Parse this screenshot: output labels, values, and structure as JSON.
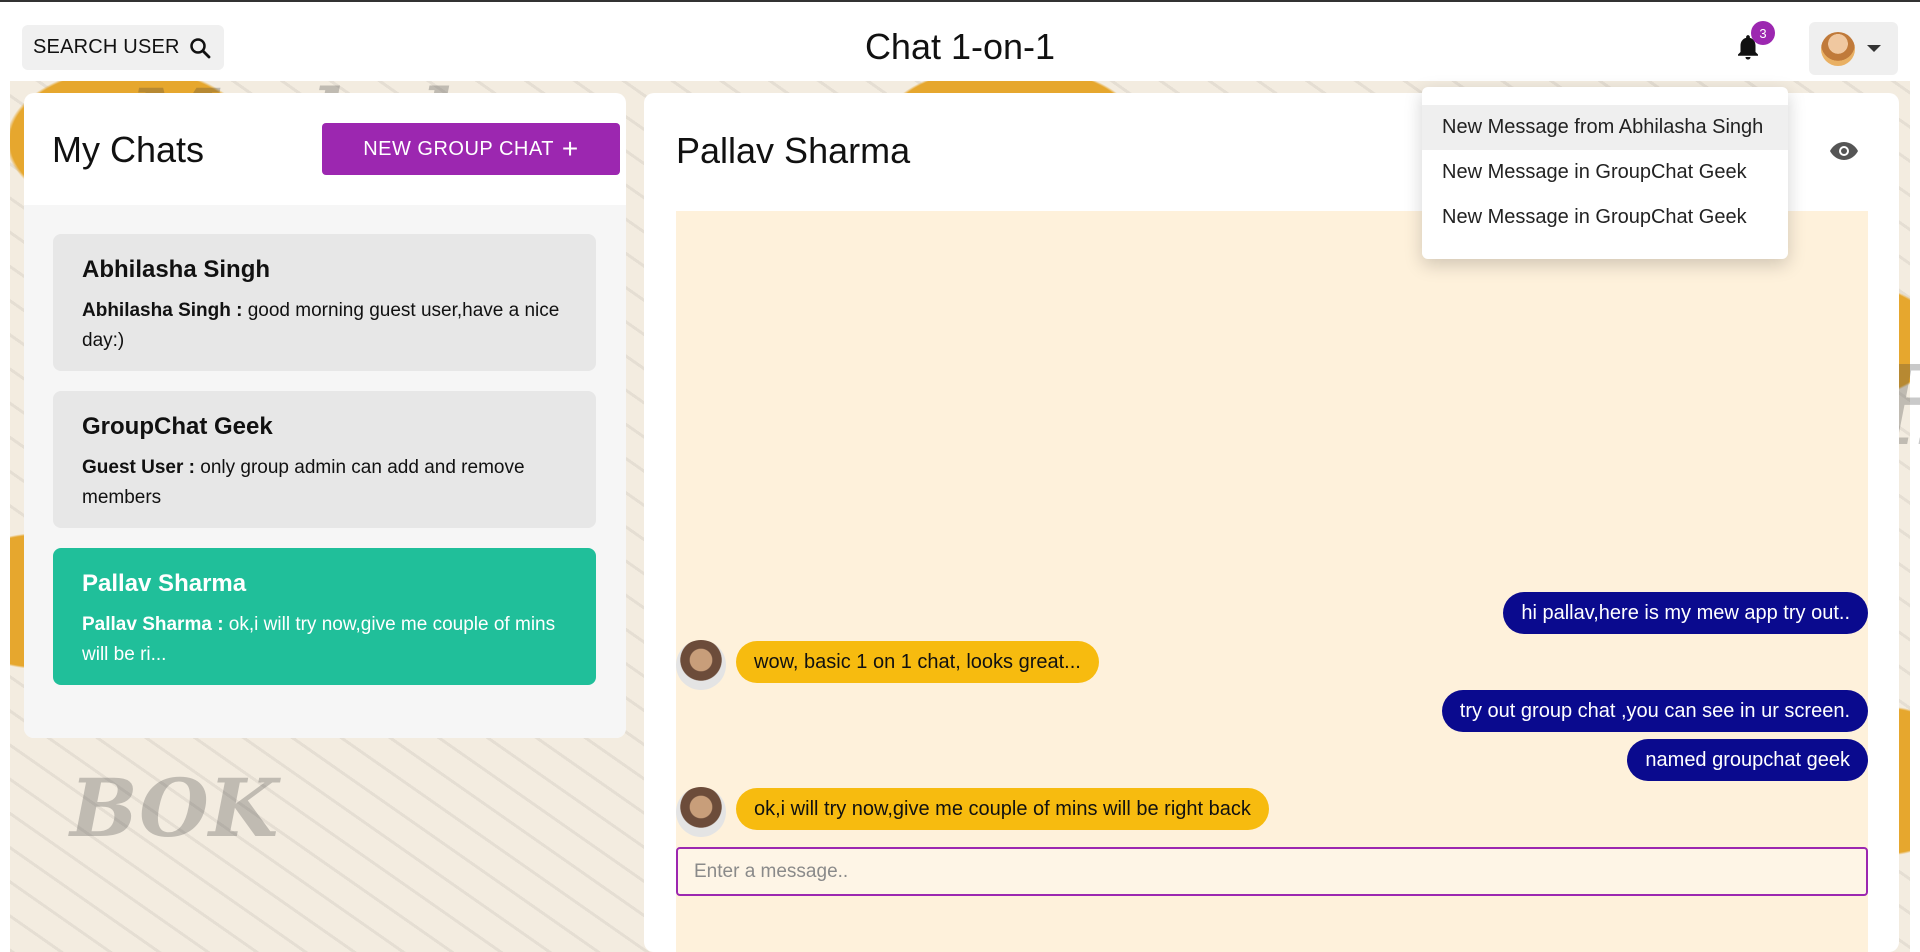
{
  "header": {
    "search_label": "SEARCH USER",
    "title": "Chat 1-on-1",
    "notification_count": "3"
  },
  "notifications": [
    "New Message from Abhilasha Singh",
    "New Message in GroupChat Geek",
    "New Message in GroupChat Geek"
  ],
  "sidebar": {
    "title": "My Chats",
    "new_group_label": "NEW GROUP CHAT",
    "chats": [
      {
        "name": "Abhilasha Singh",
        "sender": "Abhilasha Singh :",
        "message": " good morning guest user,have a nice day:)",
        "active": false
      },
      {
        "name": "GroupChat Geek",
        "sender": "Guest User :",
        "message": " only group admin can add and remove members",
        "active": false
      },
      {
        "name": "Pallav Sharma",
        "sender": "Pallav Sharma :",
        "message": " ok,i will try now,give me couple of mins will be ri...",
        "active": true
      }
    ]
  },
  "chat": {
    "title": "Pallav Sharma",
    "messages": [
      {
        "text": "hi pallav,here is my mew app try out..",
        "mine": true
      },
      {
        "text": "wow, basic 1 on 1 chat, looks great...",
        "mine": false
      },
      {
        "text": "try out group chat ,you can see in ur screen.",
        "mine": true
      },
      {
        "text": "named groupchat geek",
        "mine": true
      },
      {
        "text": "ok,i will try now,give me couple of mins will be right back",
        "mine": false
      }
    ],
    "input_placeholder": "Enter a message.."
  },
  "colors": {
    "accent": "#9c27b0",
    "active_chat": "#20bf9a",
    "my_bubble": "#0a0a8e",
    "their_bubble": "#f7bb0f"
  },
  "icons": {
    "search": "search-icon",
    "bell": "bell-icon",
    "eye": "eye-icon",
    "plus": "plus-icon",
    "caret": "caret-down-icon"
  }
}
